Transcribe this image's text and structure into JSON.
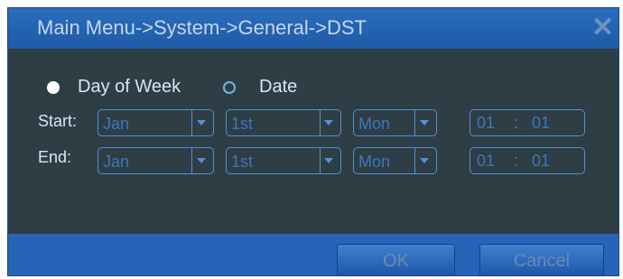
{
  "title": "Main Menu->System->General->DST",
  "mode_options": {
    "day_of_week": "Day of Week",
    "date": "Date",
    "selected": "day_of_week"
  },
  "start": {
    "label": "Start:",
    "month": "Jan",
    "ordinal": "1st",
    "weekday": "Mon",
    "hour": "01",
    "sep": ":",
    "minute": "01"
  },
  "end": {
    "label": "End:",
    "month": "Jan",
    "ordinal": "1st",
    "weekday": "Mon",
    "hour": "01",
    "sep": ":",
    "minute": "01"
  },
  "buttons": {
    "ok": "OK",
    "cancel": "Cancel"
  },
  "icons": {
    "close": "close-icon",
    "radio_selected": "radio-selected-icon",
    "radio_unselected": "radio-unselected-icon"
  },
  "colors": {
    "title_bar": "#2a6dbe",
    "body": "#2f3d45",
    "field_border": "#4f93d6",
    "field_text": "#3a79bd"
  }
}
